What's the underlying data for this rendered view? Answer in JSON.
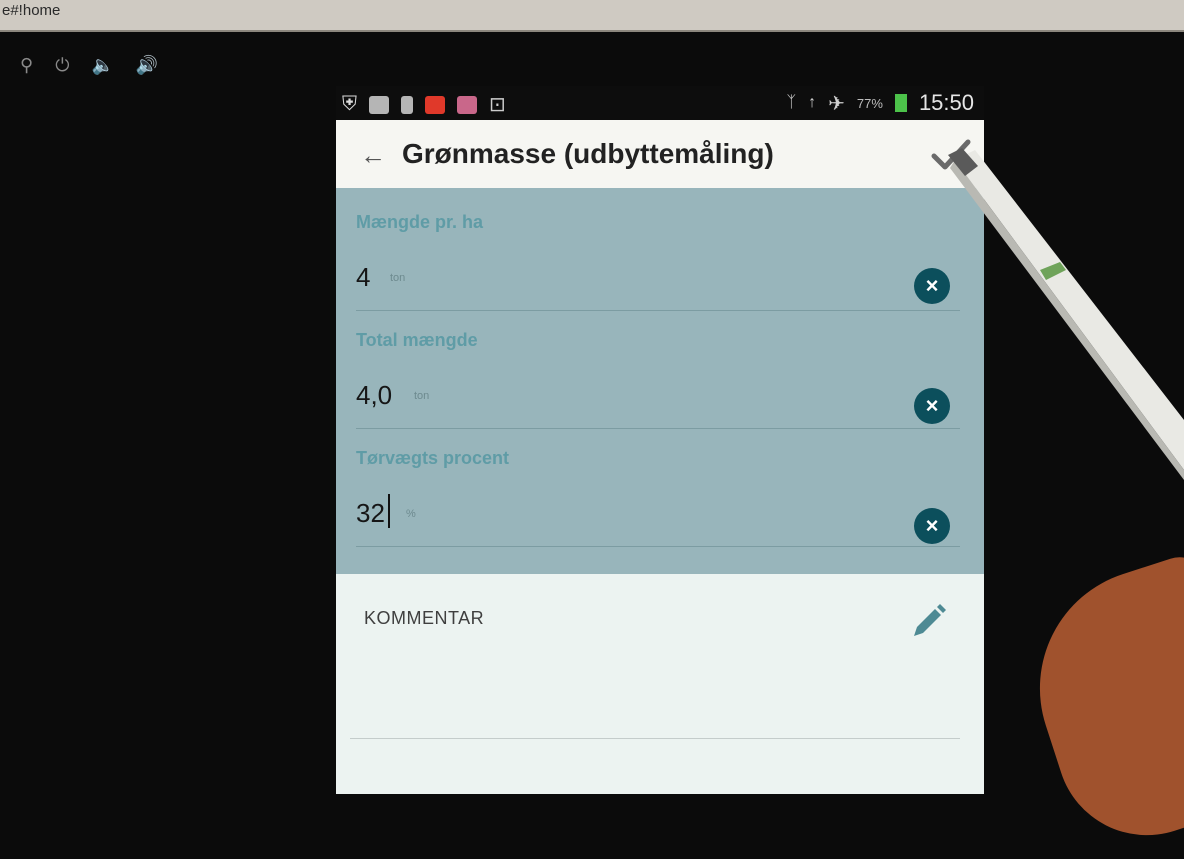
{
  "host": {
    "url_fragment": "e#!home",
    "icons": [
      "search-icon",
      "power-icon",
      "volume-down-icon",
      "volume-up-icon"
    ]
  },
  "statusbar": {
    "left_icons": [
      "shield-icon",
      "keyboard-icon",
      "sim-icon",
      "app-icon-red",
      "gallery-icon",
      "usb-icon"
    ],
    "right_icons": [
      "bluetooth-icon",
      "wifi-icon",
      "airplane-icon",
      "battery-icon"
    ],
    "battery_percent": "77%",
    "time": "15:50"
  },
  "appbar": {
    "back_icon": "arrow-left-icon",
    "title": "Grønmasse (udbyttemåling)",
    "confirm_icon": "checkmark-icon"
  },
  "fields": [
    {
      "label": "Mængde pr. ha",
      "value": "4",
      "unit": "ton"
    },
    {
      "label": "Total mængde",
      "value": "4,0",
      "unit": "ton"
    },
    {
      "label": "Tørvægts procent",
      "value": "32",
      "unit": "%"
    }
  ],
  "comment": {
    "label": "KOMMENTAR",
    "edit_icon": "pencil-icon"
  },
  "colors": {
    "form_background": "#98b5bb",
    "label_teal": "#5f9ca6",
    "clear_button": "#0c4f5c",
    "appbar": "#f6f6f2"
  }
}
